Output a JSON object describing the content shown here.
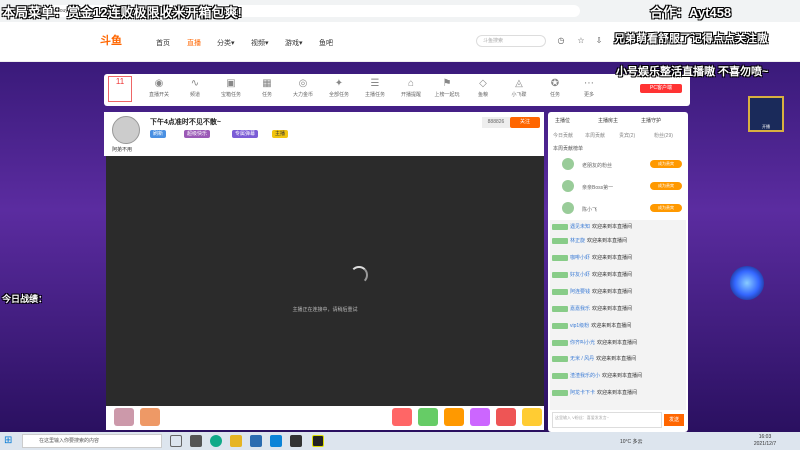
{
  "overlay": {
    "top_left": "本局菜单：赏金12连败极限收米开箱包爽!",
    "top_right": "合作：Ayt458",
    "right_line1": "兄弟萌看舒服了记得点点关注嗷",
    "right_line2": "小号娱乐整活直播嗷 不喜勿喷~",
    "left_line1": "今日战绩："
  },
  "browser": {
    "url": "https://www.douyu.com/topic/..."
  },
  "header": {
    "logo": "斗鱼",
    "nav": [
      "首页",
      "直播",
      "分类▾",
      "视频▾",
      "游戏▾",
      "鱼吧"
    ],
    "search_placeholder": "斗鱼搜索"
  },
  "toolbar": {
    "day_label": "11",
    "items": [
      "直播开关",
      "频道",
      "宝箱任务",
      "任务",
      "大力金币",
      "全部任务",
      "主播任务",
      "开播提醒",
      "上榜一起玩",
      "鱼粮",
      "小飞碟",
      "任务",
      "更多"
    ],
    "pc_client": "PC客户端"
  },
  "room": {
    "title": "下午4点准时不见不散~",
    "tags": [
      "刷新",
      "超级快乐",
      "专属弹幕",
      "主播"
    ],
    "follow_label": "关注",
    "follow_count": "888826",
    "anchor_name": "阿弟不用"
  },
  "video": {
    "message": "主播正在连接中，请稍后重试"
  },
  "side": {
    "tabs": [
      "主播位",
      "主播房主",
      "主播守护"
    ],
    "rank_tabs": [
      "今日贡献",
      "本周贡献",
      "贵宾(2)",
      "粉丝(29)"
    ],
    "rank_title": "本周贡献榜单",
    "rank_rows": [
      {
        "name": "老朋友的粉丝",
        "btn": "成为贵宾"
      },
      {
        "name": "亲亲Boss第一",
        "btn": "成为贵宾"
      },
      {
        "name": "陈小飞",
        "btn": "成为贵宾"
      }
    ],
    "chat": [
      {
        "name": "遇见未知",
        "msg": "欢迎来到本直播间"
      },
      {
        "name": "林正旋",
        "msg": "欢迎来到本直播间"
      },
      {
        "name": "咖啡小虾",
        "msg": "欢迎来到本直播间"
      },
      {
        "name": "好友小虾",
        "msg": "欢迎来到本直播间"
      },
      {
        "name": "阿连要钱",
        "msg": "欢迎来到本直播间"
      },
      {
        "name": "嘉嘉我乐",
        "msg": "欢迎来到本直播间"
      },
      {
        "name": "vip1级粉",
        "msg": "欢迎来到本直播间"
      },
      {
        "name": "你齐叫小光",
        "msg": "欢迎来到本直播间"
      },
      {
        "name": "无米 / 风丹",
        "msg": "欢迎来到本直播间"
      },
      {
        "name": "渣渣我乐的小",
        "msg": "欢迎来到本直播间"
      },
      {
        "name": "阿龙卡下卡",
        "msg": "欢迎来到本直播间"
      }
    ],
    "input_placeholder": "这里输入 V粉丝：喜爱发发言~",
    "send": "发送"
  },
  "widget": {
    "label": "开播"
  },
  "taskbar": {
    "search_placeholder": "在这里输入你要搜索的内容",
    "weather": "10°C 多云",
    "time": "16:03",
    "date": "2021/12/7"
  }
}
